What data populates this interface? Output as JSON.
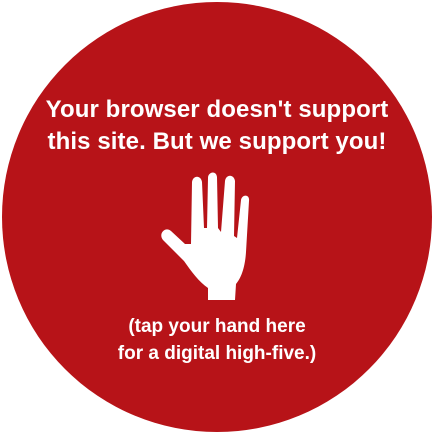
{
  "notice": {
    "headline_line1": "Your browser doesn't support",
    "headline_line2": "this site. But we support you!",
    "hint_line1": "(tap your hand here",
    "hint_line2": "for a digital high-five.)"
  },
  "icons": {
    "hand": "raised-hand-icon"
  },
  "colors": {
    "circle_background": "#b71318",
    "text": "#ffffff",
    "page_background": "#ffffff"
  }
}
